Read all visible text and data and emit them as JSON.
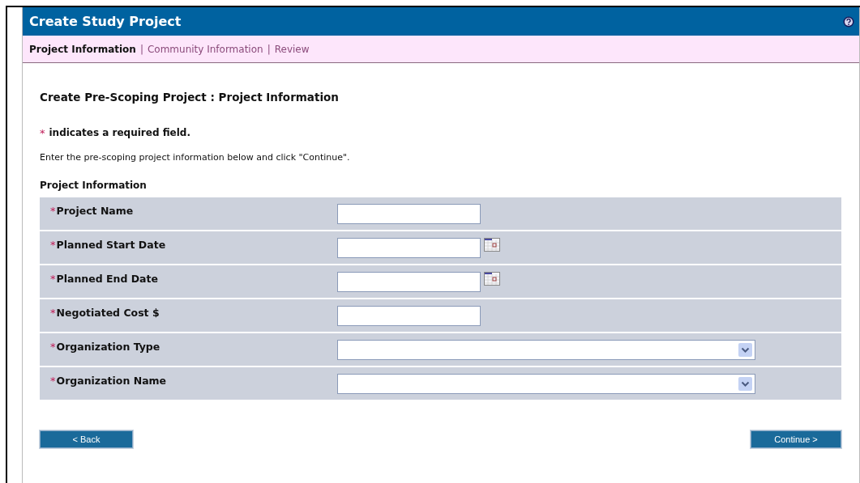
{
  "window": {
    "title": "Create Study Project"
  },
  "tabs": [
    {
      "label": "Project Information",
      "selected": true
    },
    {
      "label": "Community Information",
      "selected": false
    },
    {
      "label": "Review",
      "selected": false
    }
  ],
  "tab_separator": "|",
  "heading": "Create Pre-Scoping Project : Project Information",
  "required_note": {
    "mark": "*",
    "text": "indicates a required field."
  },
  "instructions": "Enter the pre-scoping project information below and click \"Continue\".",
  "section_title": "Project Information",
  "fields": [
    {
      "kind": "text",
      "mark": "*",
      "label": "Project Name"
    },
    {
      "kind": "date",
      "mark": "*",
      "label": "Planned Start Date"
    },
    {
      "kind": "date",
      "mark": "*",
      "label": "Planned End Date"
    },
    {
      "kind": "text",
      "mark": "*",
      "label": "Negotiated Cost $"
    },
    {
      "kind": "select",
      "mark": "*",
      "label": "Organization Type"
    },
    {
      "kind": "select",
      "mark": "*",
      "label": "Organization Name"
    }
  ],
  "buttons": {
    "back": "< Back",
    "continue": "Continue >"
  }
}
